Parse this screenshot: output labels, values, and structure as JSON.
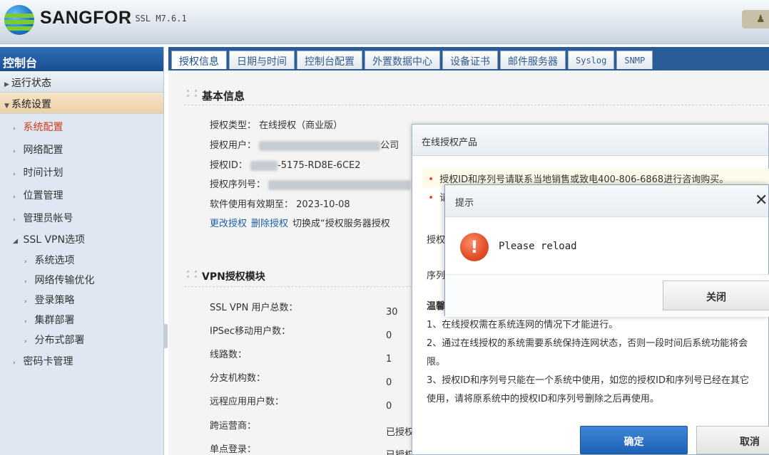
{
  "header": {
    "brand": "SANGFOR",
    "version": "| SSL M7.6.1"
  },
  "sidebar": {
    "title": "控制台",
    "groups": [
      {
        "label": "运行状态"
      },
      {
        "label": "系统设置"
      }
    ],
    "items": [
      {
        "label": "系统配置"
      },
      {
        "label": "网络配置"
      },
      {
        "label": "时间计划"
      },
      {
        "label": "位置管理"
      },
      {
        "label": "管理员帐号"
      },
      {
        "label": "SSL VPN选项"
      },
      {
        "label": "系统选项"
      },
      {
        "label": "网络传输优化"
      },
      {
        "label": "登录策略"
      },
      {
        "label": "集群部署"
      },
      {
        "label": "分布式部署"
      },
      {
        "label": "密码卡管理"
      }
    ]
  },
  "tabs": [
    "授权信息",
    "日期与时间",
    "控制台配置",
    "外置数据中心",
    "设备证书",
    "邮件服务器",
    "Syslog",
    "SNMP"
  ],
  "basic": {
    "title": "基本信息",
    "auth_type": "授权类型： 在线授权（商业版）",
    "auth_user": "授权用户：",
    "auth_user_suffix": "公司",
    "auth_id": "授权ID：",
    "auth_id_partial": "-5175-RD8E-6CE2",
    "serial": "授权序列号：",
    "expire": "软件使用有效期至： 2023-10-08",
    "links": [
      "更改授权",
      "删除授权",
      "切换成“授权服务器授权"
    ]
  },
  "vpn": {
    "title": "VPN授权模块",
    "rows": [
      {
        "label": "SSL VPN 用户总数：",
        "value": "30"
      },
      {
        "label": "IPSec移动用户数：",
        "value": "0"
      },
      {
        "label": "线路数：",
        "value": "1"
      },
      {
        "label": "分支机构数：",
        "value": "0"
      },
      {
        "label": "远程应用用户数：",
        "value": "0"
      },
      {
        "label": "跨运营商：",
        "value": "已授权"
      },
      {
        "label": "单点登录：",
        "value": "已授权"
      }
    ]
  },
  "online_dialog": {
    "title": "在线授权产品",
    "tip1": "授权ID和序列号请联系当地销售或致电400-806-6868进行咨询购买。",
    "tip2": "请",
    "auth_label": "授权",
    "serial_label": "序列",
    "warm": "温馨",
    "notes": [
      "1、在线授权需在系统连网的情况下才能进行。",
      "2、通过在线授权的系统需要系统保持连网状态，否则一段时间后系统功能将会",
      "限。",
      "3、授权ID和序列号只能在一个系统中使用，如您的授权ID和序列号已经在其它",
      "使用，请将原系统中的授权ID和序列号删除之后再使用。"
    ],
    "ok": "确定",
    "cancel": "取消"
  },
  "alert": {
    "title": "提示",
    "message": "Please reload",
    "close_label": "关闭",
    "close_x": "✕"
  }
}
